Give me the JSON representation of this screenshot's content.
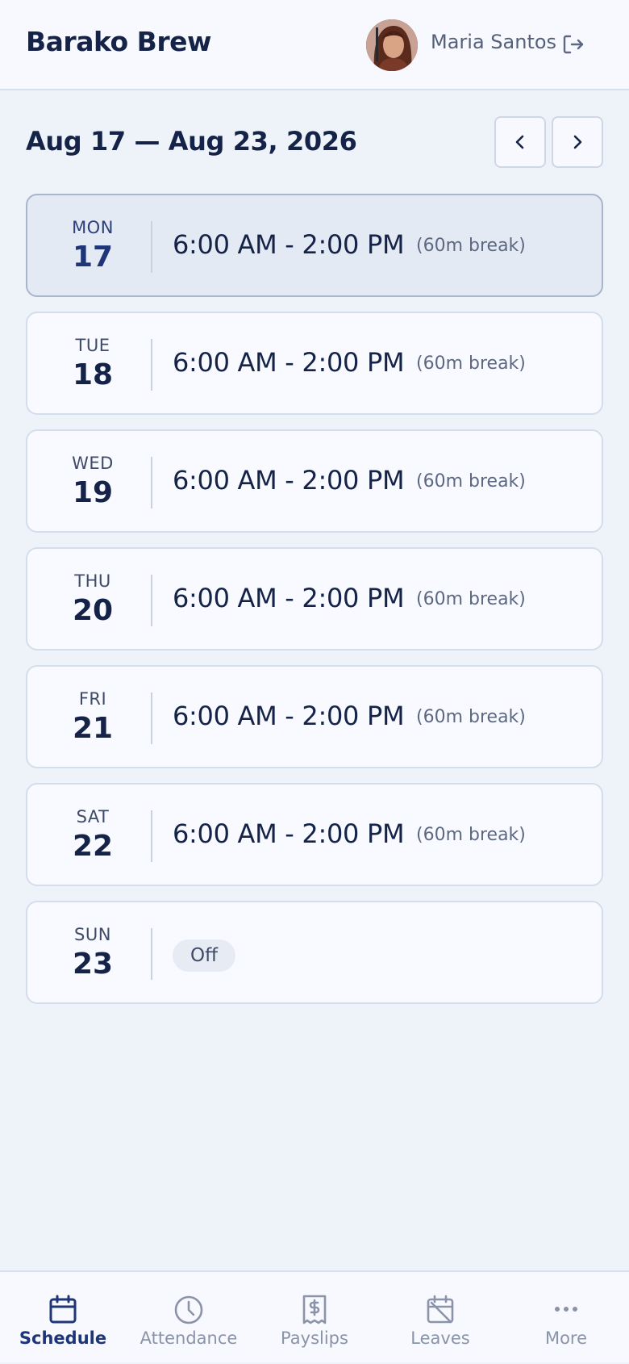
{
  "header": {
    "brand": "Barako Brew",
    "user_name": "Maria Santos"
  },
  "week": {
    "range_label": "Aug 17 — Aug 23, 2026"
  },
  "days": [
    {
      "dow": "MON",
      "date": "17",
      "time": "6:00 AM - 2:00 PM",
      "break": "(60m break)",
      "selected": true
    },
    {
      "dow": "TUE",
      "date": "18",
      "time": "6:00 AM - 2:00 PM",
      "break": "(60m break)"
    },
    {
      "dow": "WED",
      "date": "19",
      "time": "6:00 AM - 2:00 PM",
      "break": "(60m break)"
    },
    {
      "dow": "THU",
      "date": "20",
      "time": "6:00 AM - 2:00 PM",
      "break": "(60m break)"
    },
    {
      "dow": "FRI",
      "date": "21",
      "time": "6:00 AM - 2:00 PM",
      "break": "(60m break)"
    },
    {
      "dow": "SAT",
      "date": "22",
      "time": "6:00 AM - 2:00 PM",
      "break": "(60m break)"
    },
    {
      "dow": "SUN",
      "date": "23",
      "off_label": "Off"
    }
  ],
  "tabs": [
    {
      "label": "Schedule",
      "icon": "calendar-icon",
      "active": true
    },
    {
      "label": "Attendance",
      "icon": "clock-icon"
    },
    {
      "label": "Payslips",
      "icon": "receipt-icon"
    },
    {
      "label": "Leaves",
      "icon": "calendar-off-icon"
    },
    {
      "label": "More",
      "icon": "more-dots-icon"
    }
  ],
  "colors": {
    "primary": "#1e3578",
    "text": "#142347",
    "background": "#eef2f9",
    "card": "#f8faff",
    "selected_card": "#e4eaf4",
    "muted": "#8a93a8"
  }
}
